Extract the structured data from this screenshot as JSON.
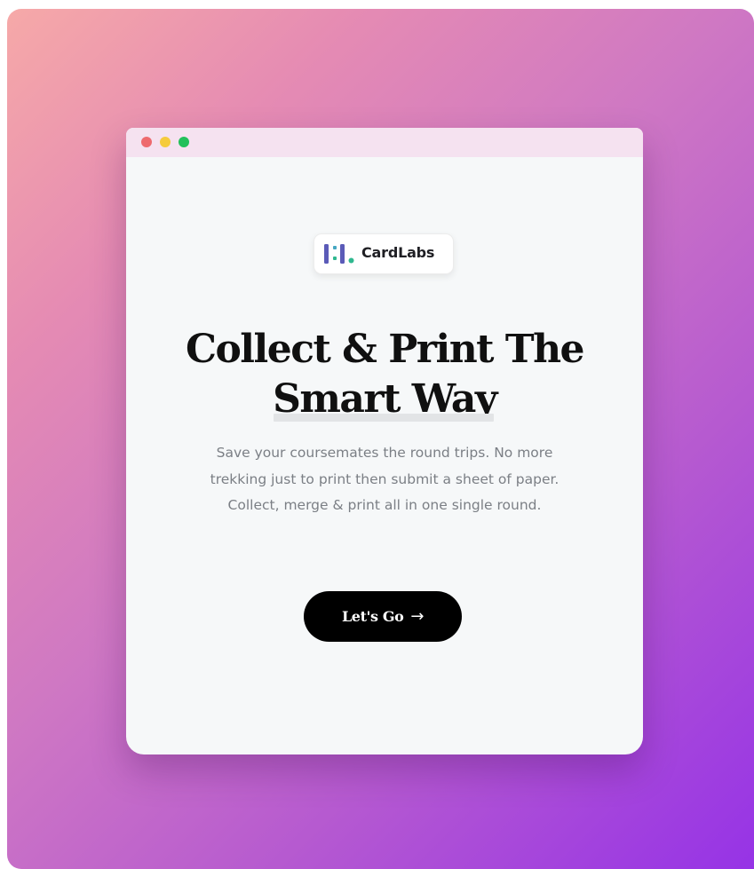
{
  "brand": {
    "name": "CardLabs",
    "logo_icon": "cardlabs-logo-icon",
    "logo_colors": [
      "#5b5bb8",
      "#45a7c2",
      "#2fb88f"
    ]
  },
  "window": {
    "controls": [
      "close",
      "minimize",
      "maximize"
    ],
    "control_colors": [
      "#ee6a6e",
      "#f5cb3c",
      "#22c05a"
    ]
  },
  "hero": {
    "headline_line1": "Collect & Print The",
    "headline_line2": "Smart Way",
    "subtitle": "Save your coursemates the round trips. No more trekking just to print then submit a sheet of paper. Collect, merge & print all in one single round."
  },
  "cta": {
    "label": "Let's Go",
    "icon": "arrow-right-icon",
    "arrow_glyph": "→"
  },
  "colors": {
    "background_gradient": [
      "#f6a9a8",
      "#9633e6"
    ],
    "button": "#000000",
    "titlebar": "#f5e2f0"
  }
}
